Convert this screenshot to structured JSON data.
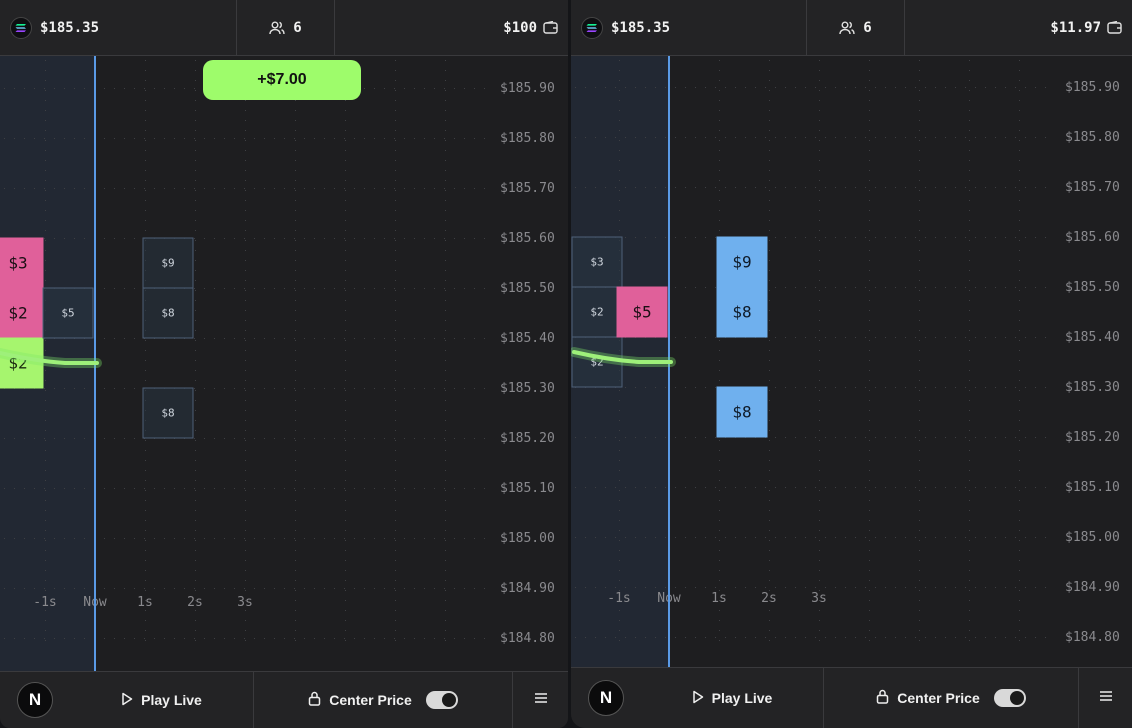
{
  "panels": [
    {
      "id": "p1",
      "header": {
        "price": "$185.35",
        "players": "6",
        "balance": "$100"
      },
      "toast": "+$7.00",
      "y_labels": [
        "$185.90",
        "$185.80",
        "$185.70",
        "$185.60",
        "$185.50",
        "$185.40",
        "$185.30",
        "$185.20",
        "$185.10",
        "$185.00",
        "$184.90",
        "$184.80"
      ],
      "x_labels": [
        "-1s",
        "Now",
        "1s",
        "2s",
        "3s"
      ],
      "bets": [
        {
          "label": "$3",
          "style": "pink",
          "time_slot": -2,
          "price_band": "185.50-185.60"
        },
        {
          "label": "$2",
          "style": "pink",
          "time_slot": -2,
          "price_band": "185.40-185.50"
        },
        {
          "label": "$2",
          "style": "green",
          "time_slot": -2,
          "price_band": "185.30-185.40"
        },
        {
          "label": "$5",
          "style": "outline",
          "time_slot": -1,
          "price_band": "185.40-185.50"
        },
        {
          "label": "$9",
          "style": "outline",
          "time_slot": 1,
          "price_band": "185.50-185.60"
        },
        {
          "label": "$8",
          "style": "outline",
          "time_slot": 1,
          "price_band": "185.40-185.50"
        },
        {
          "label": "$8",
          "style": "outline",
          "time_slot": 1,
          "price_band": "185.20-185.30"
        }
      ],
      "bottom": {
        "play_label": "Play Live",
        "center_label": "Center Price",
        "logo": "N"
      }
    },
    {
      "id": "p2",
      "header": {
        "price": "$185.35",
        "players": "6",
        "balance": "$11.97"
      },
      "toast": "",
      "y_labels": [
        "$185.90",
        "$185.80",
        "$185.70",
        "$185.60",
        "$185.50",
        "$185.40",
        "$185.30",
        "$185.20",
        "$185.10",
        "$185.00",
        "$184.90",
        "$184.80"
      ],
      "x_labels": [
        "-1s",
        "Now",
        "1s",
        "2s",
        "3s"
      ],
      "bets": [
        {
          "label": "$3",
          "style": "outline",
          "time_slot": -2,
          "price_band": "185.50-185.60"
        },
        {
          "label": "$2",
          "style": "outline",
          "time_slot": -2,
          "price_band": "185.40-185.50"
        },
        {
          "label": "$2",
          "style": "outline",
          "time_slot": -2,
          "price_band": "185.30-185.40"
        },
        {
          "label": "$5",
          "style": "pink",
          "time_slot": -1,
          "price_band": "185.40-185.50"
        },
        {
          "label": "$9",
          "style": "blue",
          "time_slot": 1,
          "price_band": "185.50-185.60"
        },
        {
          "label": "$8",
          "style": "blue",
          "time_slot": 1,
          "price_band": "185.40-185.50"
        },
        {
          "label": "$8",
          "style": "blue",
          "time_slot": 1,
          "price_band": "185.20-185.30"
        }
      ],
      "bottom": {
        "play_label": "Play Live",
        "center_label": "Center Price",
        "logo": "N"
      }
    }
  ],
  "colors": {
    "pink": "#e0609a",
    "green": "#a6f56e",
    "blue": "#6fb0ee",
    "now_line": "#5a9ae6",
    "grid_dot": "#3f4044",
    "axis_text": "#8a8a8e"
  }
}
